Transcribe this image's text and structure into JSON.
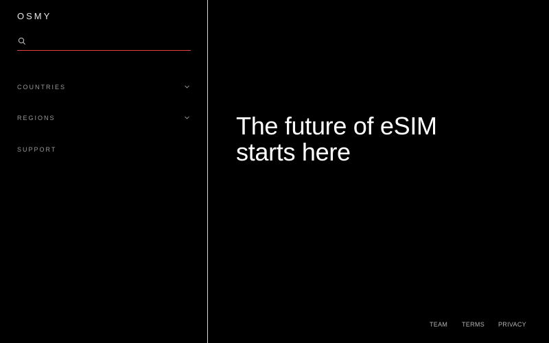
{
  "brand": {
    "logo_text": "OSMY"
  },
  "colors": {
    "background": "#000000",
    "accent": "#e0443a",
    "divider": "#d9d9d9",
    "nav_text": "#9a9a9a"
  },
  "search": {
    "value": "",
    "placeholder": "",
    "icon": "search-icon"
  },
  "sidebar": {
    "items": [
      {
        "label": "COUNTRIES",
        "icon": "chevron-down-icon"
      },
      {
        "label": "REGIONS",
        "icon": "chevron-down-icon"
      },
      {
        "label": "SUPPORT"
      }
    ]
  },
  "hero": {
    "line1": "The future of eSIM",
    "line2": "starts here"
  },
  "footer": {
    "links": [
      {
        "label": "TEAM"
      },
      {
        "label": "TERMS"
      },
      {
        "label": "PRIVACY"
      }
    ]
  }
}
